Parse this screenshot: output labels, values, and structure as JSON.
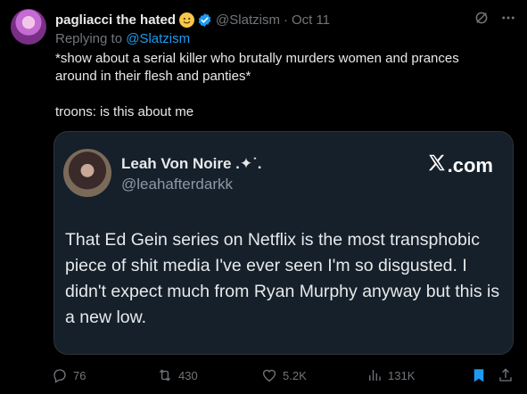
{
  "tweet": {
    "display_name": "pagliacci the hated",
    "handle": "@Slatzism",
    "separator": "·",
    "date": "Oct 11",
    "reply_prefix": "Replying to",
    "reply_to": "@Slatzism",
    "text_line1": "*show about a serial killer who brutally murders women and prances around in their flesh and panties*",
    "text_line2": "troons: is this about me",
    "emoji_icon": "smiling-face-emoji",
    "verified_color": "#1d9bf0"
  },
  "quote": {
    "display_name": "Leah Von Noire .✦˙.",
    "handle": "@leahafterdarkk",
    "source_label": ".com",
    "text": "That Ed Gein series on Netflix is the most transphobic piece of shit media I've ever seen I'm so disgusted. I didn't expect much from Ryan Murphy anyway but this is a new low."
  },
  "actions": {
    "replies": "76",
    "reposts": "430",
    "likes": "5.2K",
    "views": "131K"
  },
  "colors": {
    "background": "#000000",
    "card": "#15202b",
    "accent": "#1d9bf0",
    "muted": "#71767b"
  }
}
